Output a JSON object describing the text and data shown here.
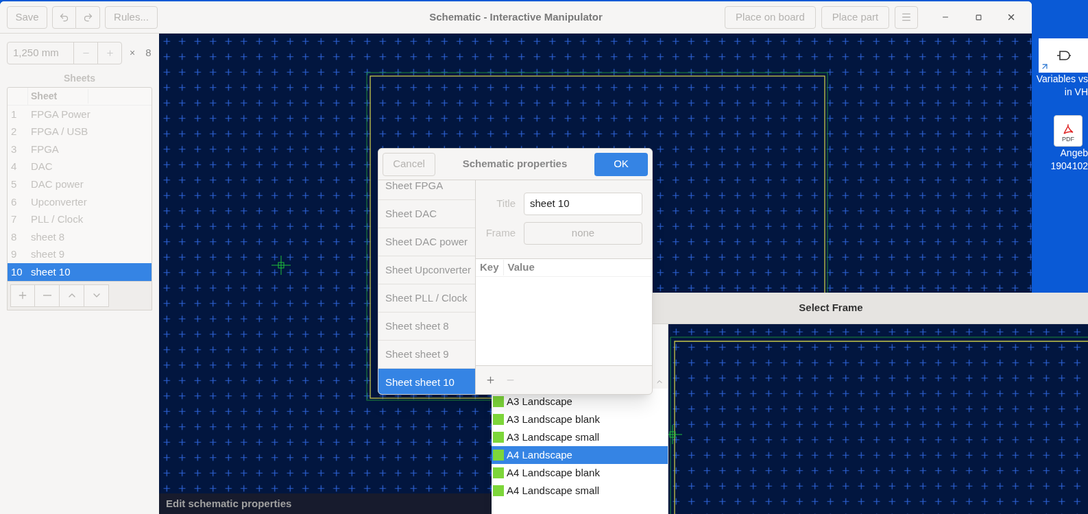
{
  "main_window": {
    "title": "Schematic - Interactive Manipulator",
    "save": "Save",
    "rules": "Rules...",
    "place_on_board": "Place on board",
    "place_part": "Place part"
  },
  "grid_field": {
    "value": "1,250 mm",
    "multiplier": "×",
    "count": "8"
  },
  "sheets": {
    "heading": "Sheets",
    "column": "Sheet",
    "rows": [
      {
        "number": "1",
        "name": "FPGA Power",
        "selected": false
      },
      {
        "number": "2",
        "name": "FPGA / USB",
        "selected": false
      },
      {
        "number": "3",
        "name": "FPGA",
        "selected": false
      },
      {
        "number": "4",
        "name": "DAC",
        "selected": false
      },
      {
        "number": "5",
        "name": "DAC power",
        "selected": false
      },
      {
        "number": "6",
        "name": "Upconverter",
        "selected": false
      },
      {
        "number": "7",
        "name": "PLL / Clock",
        "selected": false
      },
      {
        "number": "8",
        "name": "sheet 8",
        "selected": false
      },
      {
        "number": "9",
        "name": "sheet 9",
        "selected": false
      },
      {
        "number": "10",
        "name": "sheet 10",
        "selected": true
      }
    ]
  },
  "status": "Edit schematic properties",
  "dialog": {
    "title": "Schematic properties",
    "cancel": "Cancel",
    "ok": "OK",
    "sheets": [
      {
        "label": "Sheet FPGA",
        "selected": false
      },
      {
        "label": "Sheet DAC",
        "selected": false
      },
      {
        "label": "Sheet DAC power",
        "selected": false
      },
      {
        "label": "Sheet Upconverter",
        "selected": false
      },
      {
        "label": "Sheet PLL / Clock",
        "selected": false
      },
      {
        "label": "Sheet sheet 8",
        "selected": false
      },
      {
        "label": "Sheet sheet 9",
        "selected": false
      },
      {
        "label": "Sheet sheet 10",
        "selected": true
      }
    ],
    "title_label": "Title",
    "title_value": "sheet 10",
    "frame_label": "Frame",
    "frame_value": "none",
    "columns": [
      "Key",
      "Value"
    ]
  },
  "select_frame": {
    "title": "Select Frame",
    "frames": [
      {
        "name": "A3 Landscape",
        "selected": false
      },
      {
        "name": "A3 Landscape blank",
        "selected": false
      },
      {
        "name": "A3 Landscape small",
        "selected": false
      },
      {
        "name": "A4 Landscape",
        "selected": true
      },
      {
        "name": "A4 Landscape blank",
        "selected": false
      },
      {
        "name": "A4 Landscape small",
        "selected": false
      }
    ]
  },
  "desktop_icons": [
    {
      "kind": "shortcut",
      "lines": [
        "Variables vs",
        "in VH"
      ]
    },
    {
      "kind": "pdf",
      "badge": "PDF",
      "lines": [
        "Angeb",
        "1904102"
      ]
    }
  ]
}
